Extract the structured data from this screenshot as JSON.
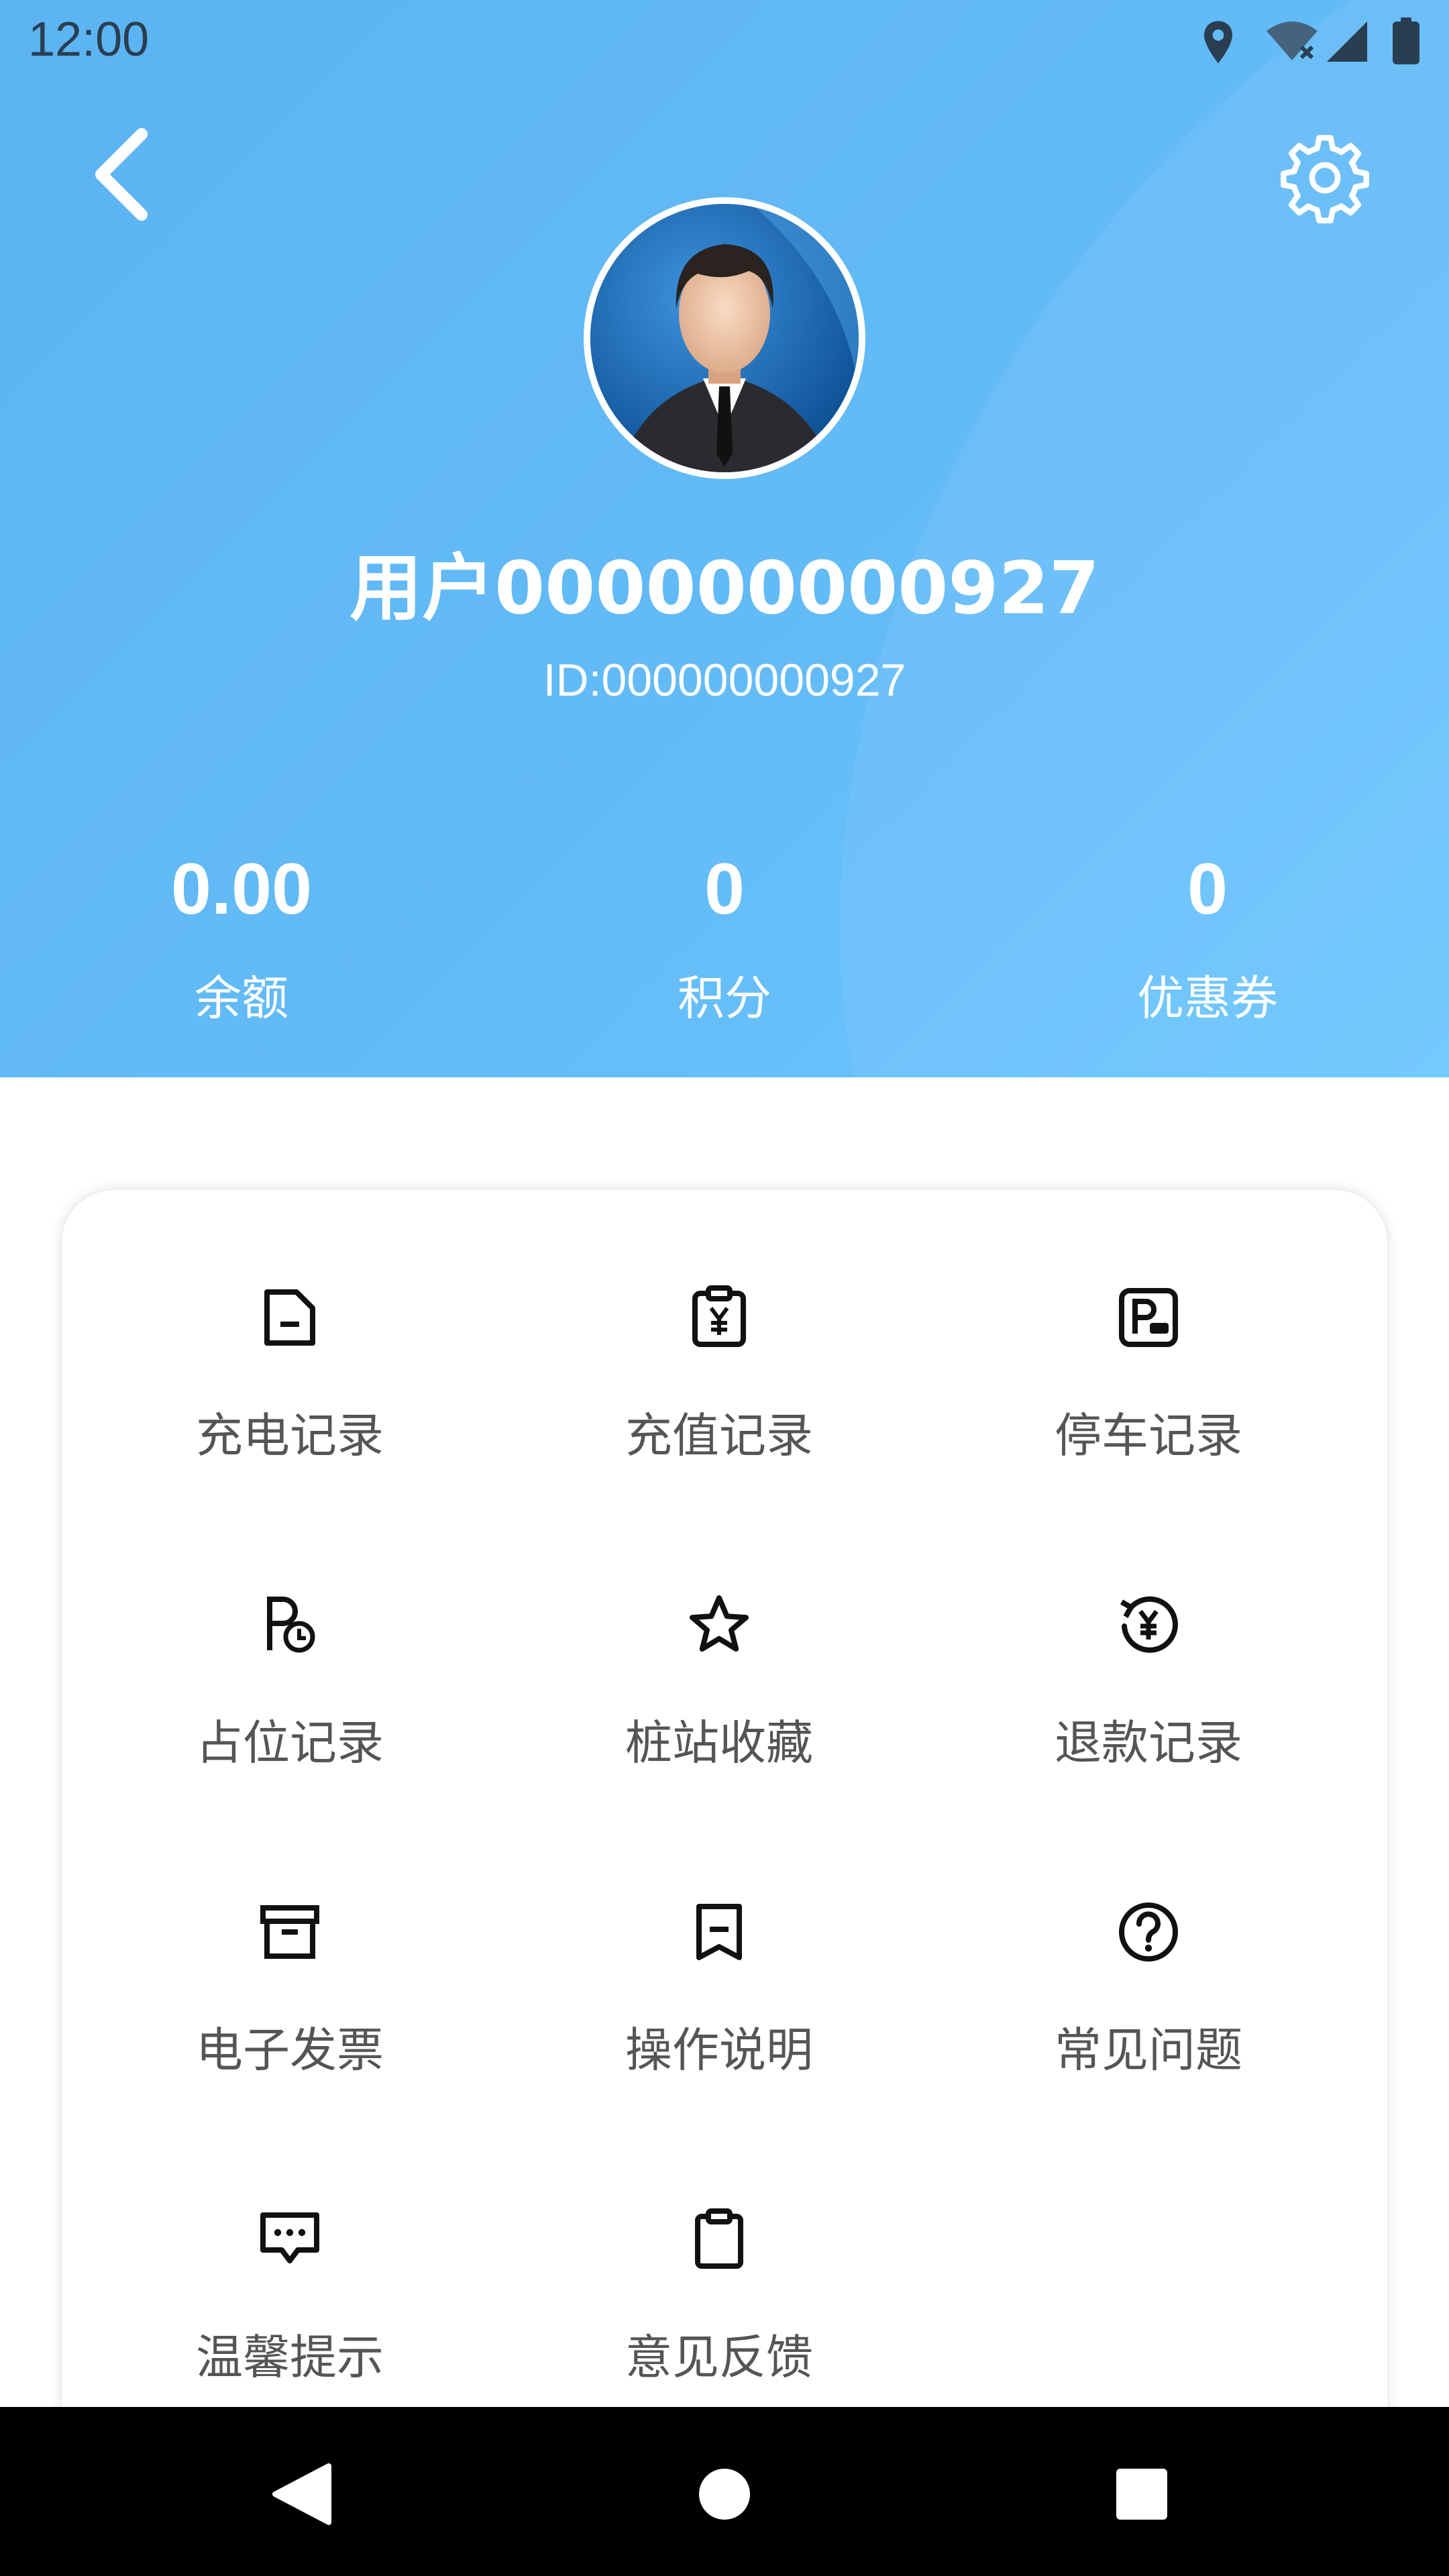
{
  "status_bar": {
    "time": "12:00",
    "icons": [
      "location-icon",
      "wifi-icon",
      "signal-icon",
      "battery-icon"
    ]
  },
  "header": {
    "back_icon": "chevron-left-icon",
    "settings_icon": "gear-icon",
    "user_name": "用户000000000927",
    "user_id": "ID:000000000927",
    "stats": [
      {
        "value": "0.00",
        "label": "余额"
      },
      {
        "value": "0",
        "label": "积分"
      },
      {
        "value": "0",
        "label": "优惠券"
      }
    ]
  },
  "menu": {
    "items": [
      {
        "label": "充电记录",
        "icon": "document-icon"
      },
      {
        "label": "充值记录",
        "icon": "clipboard-yen-icon"
      },
      {
        "label": "停车记录",
        "icon": "parking-car-icon"
      },
      {
        "label": "占位记录",
        "icon": "parking-clock-icon"
      },
      {
        "label": "桩站收藏",
        "icon": "star-icon"
      },
      {
        "label": "退款记录",
        "icon": "refund-yen-icon"
      },
      {
        "label": "电子发票",
        "icon": "archive-box-icon"
      },
      {
        "label": "操作说明",
        "icon": "bookmark-icon"
      },
      {
        "label": "常见问题",
        "icon": "question-circle-icon"
      },
      {
        "label": "温馨提示",
        "icon": "chat-bubble-icon"
      },
      {
        "label": "意见反馈",
        "icon": "clipboard-icon"
      }
    ]
  },
  "colors": {
    "header_gradient_start": "#5cb3f2",
    "header_gradient_end": "#6cc6ff",
    "menu_label": "#555555",
    "nav_bar": "#000000"
  },
  "nav_bar": {
    "icons": [
      "back-triangle-icon",
      "home-circle-icon",
      "recents-square-icon"
    ]
  }
}
